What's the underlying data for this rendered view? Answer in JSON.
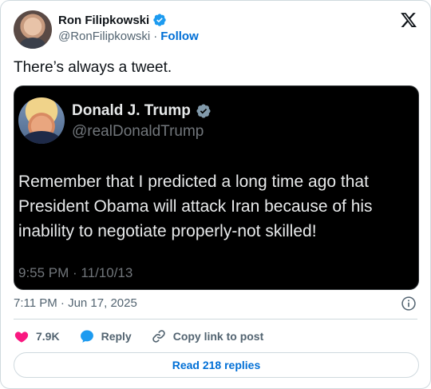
{
  "author": {
    "name": "Ron Filipkowski",
    "handle": "@RonFilipkowski",
    "separator": "·",
    "follow_label": "Follow"
  },
  "tweet": {
    "text": "There’s always a tweet.",
    "timestamp": "7:11 PM · Jun 17, 2025"
  },
  "quoted_screenshot": {
    "name": "Donald J. Trump",
    "handle": "@realDonaldTrump",
    "body": "Remember that I predicted a long time ago that President Obama will attack Iran because of his inability to negotiate properly-not skilled!",
    "time": "9:55 PM · 11/10/13"
  },
  "actions": {
    "likes": "7.9K",
    "reply_label": "Reply",
    "copy_link_label": "Copy link to post"
  },
  "read_replies_label": "Read 218 replies",
  "colors": {
    "accent": "#006fd6",
    "verified": "#1d9bf0",
    "like": "#f91880",
    "muted": "#536471"
  }
}
